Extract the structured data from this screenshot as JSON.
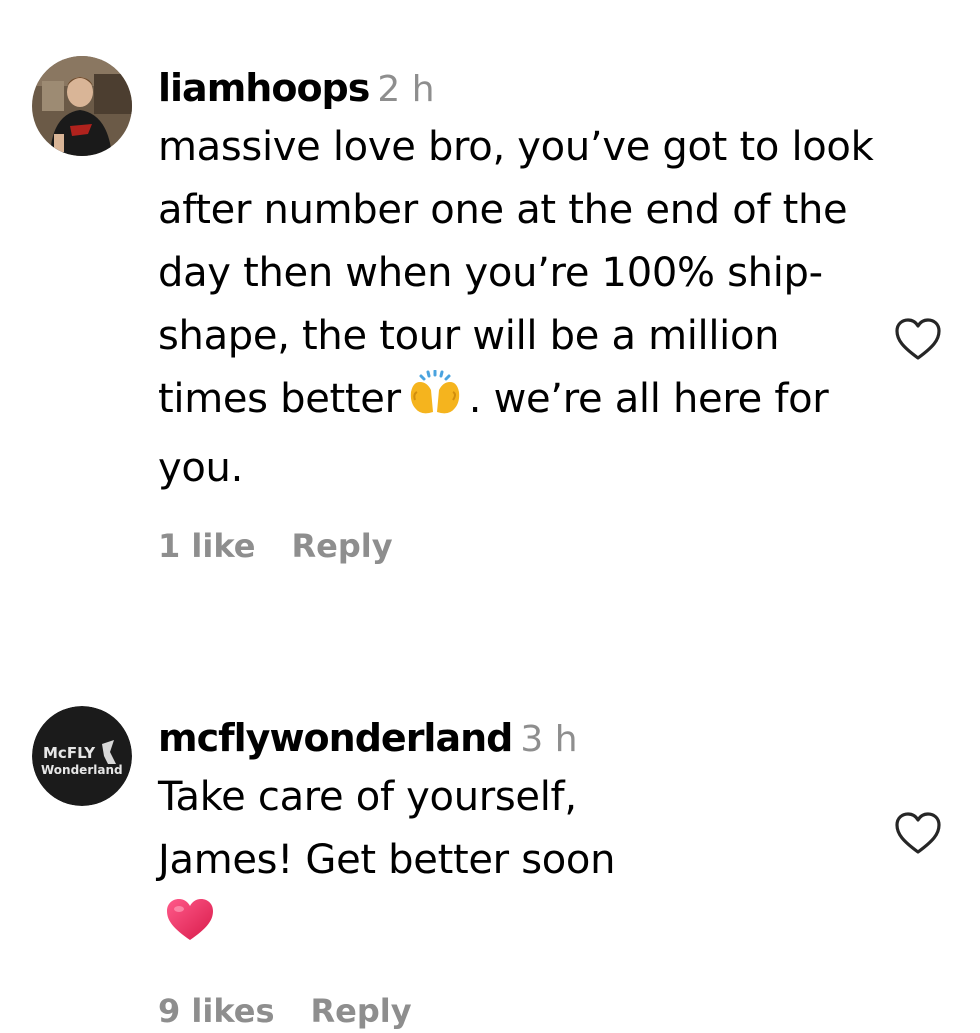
{
  "comments": [
    {
      "username": "liamhoops",
      "timestamp": "2 h",
      "text_before_emoji": "massive love bro, you’ve got to look after number one at the end of the day then when you’re 100% ship-shape, the tour will be a million times better",
      "emoji": "raising-hands-icon",
      "text_after_emoji": ". we’re all here for you.",
      "likes": "1 like",
      "reply_label": "Reply",
      "avatar": "profile-photo"
    },
    {
      "username": "mcflywonderland",
      "timestamp": "3 h",
      "text_before_emoji": "Take care of yourself, James! Get better soon",
      "emoji": "heart-icon",
      "text_after_emoji": "",
      "likes": "9 likes",
      "reply_label": "Reply",
      "avatar": "mcfly-wonderland-logo",
      "avatar_logo_text": [
        "McFLY",
        "Wonderland"
      ]
    }
  ],
  "colors": {
    "text": "#000000",
    "secondary_text": "#8e8e8e",
    "emoji_heart": "#e0245e",
    "emoji_hands": "#f5b41e"
  }
}
